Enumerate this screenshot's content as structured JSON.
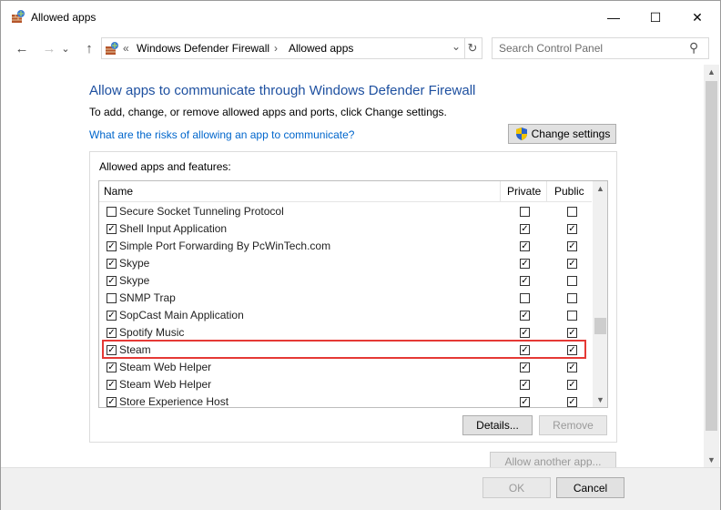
{
  "window": {
    "title": "Allowed apps",
    "icon": "firewall-icon",
    "minimize_glyph": "—",
    "maximize_glyph": "☐",
    "close_glyph": "✕"
  },
  "addressbar": {
    "back_glyph": "←",
    "forward_glyph": "→",
    "recent_glyph": "⌄",
    "up_glyph": "↑",
    "crumb_prefix": "«",
    "breadcrumbs": [
      "Windows Defender Firewall",
      "Allowed apps"
    ],
    "crumb_separator": "›",
    "dropdown_glyph": "⌄",
    "refresh_glyph": "↻",
    "search_placeholder": "Search Control Panel",
    "search_icon_glyph": "⚲"
  },
  "content": {
    "heading": "Allow apps to communicate through Windows Defender Firewall",
    "subtext": "To add, change, or remove allowed apps and ports, click Change settings.",
    "risk_link": "What are the risks of allowing an app to communicate?",
    "change_settings": "Change settings",
    "group_label": "Allowed apps and features:",
    "columns": {
      "name": "Name",
      "private": "Private",
      "public": "Public"
    },
    "apps": [
      {
        "name": "Secure Socket Tunneling Protocol",
        "enabled": false,
        "private": false,
        "public": false
      },
      {
        "name": "Shell Input Application",
        "enabled": true,
        "private": true,
        "public": true
      },
      {
        "name": "Simple Port Forwarding By PcWinTech.com",
        "enabled": true,
        "private": true,
        "public": true
      },
      {
        "name": "Skype",
        "enabled": true,
        "private": true,
        "public": true
      },
      {
        "name": "Skype",
        "enabled": true,
        "private": true,
        "public": false
      },
      {
        "name": "SNMP Trap",
        "enabled": false,
        "private": false,
        "public": false
      },
      {
        "name": "SopCast Main Application",
        "enabled": true,
        "private": true,
        "public": false
      },
      {
        "name": "Spotify Music",
        "enabled": true,
        "private": true,
        "public": true
      },
      {
        "name": "Steam",
        "enabled": true,
        "private": true,
        "public": true
      },
      {
        "name": "Steam Web Helper",
        "enabled": true,
        "private": true,
        "public": true
      },
      {
        "name": "Steam Web Helper",
        "enabled": true,
        "private": true,
        "public": true
      },
      {
        "name": "Store Experience Host",
        "enabled": true,
        "private": true,
        "public": true
      }
    ],
    "highlighted_app": "Steam",
    "details_button": "Details...",
    "remove_button": "Remove",
    "allow_another_button": "Allow another app..."
  },
  "footer": {
    "ok": "OK",
    "cancel": "Cancel"
  },
  "colors": {
    "heading": "#1e50a0",
    "link": "#0066cc",
    "highlight_border": "#e53935",
    "shield_blue": "#2a62c9",
    "shield_yellow": "#f2c300"
  }
}
